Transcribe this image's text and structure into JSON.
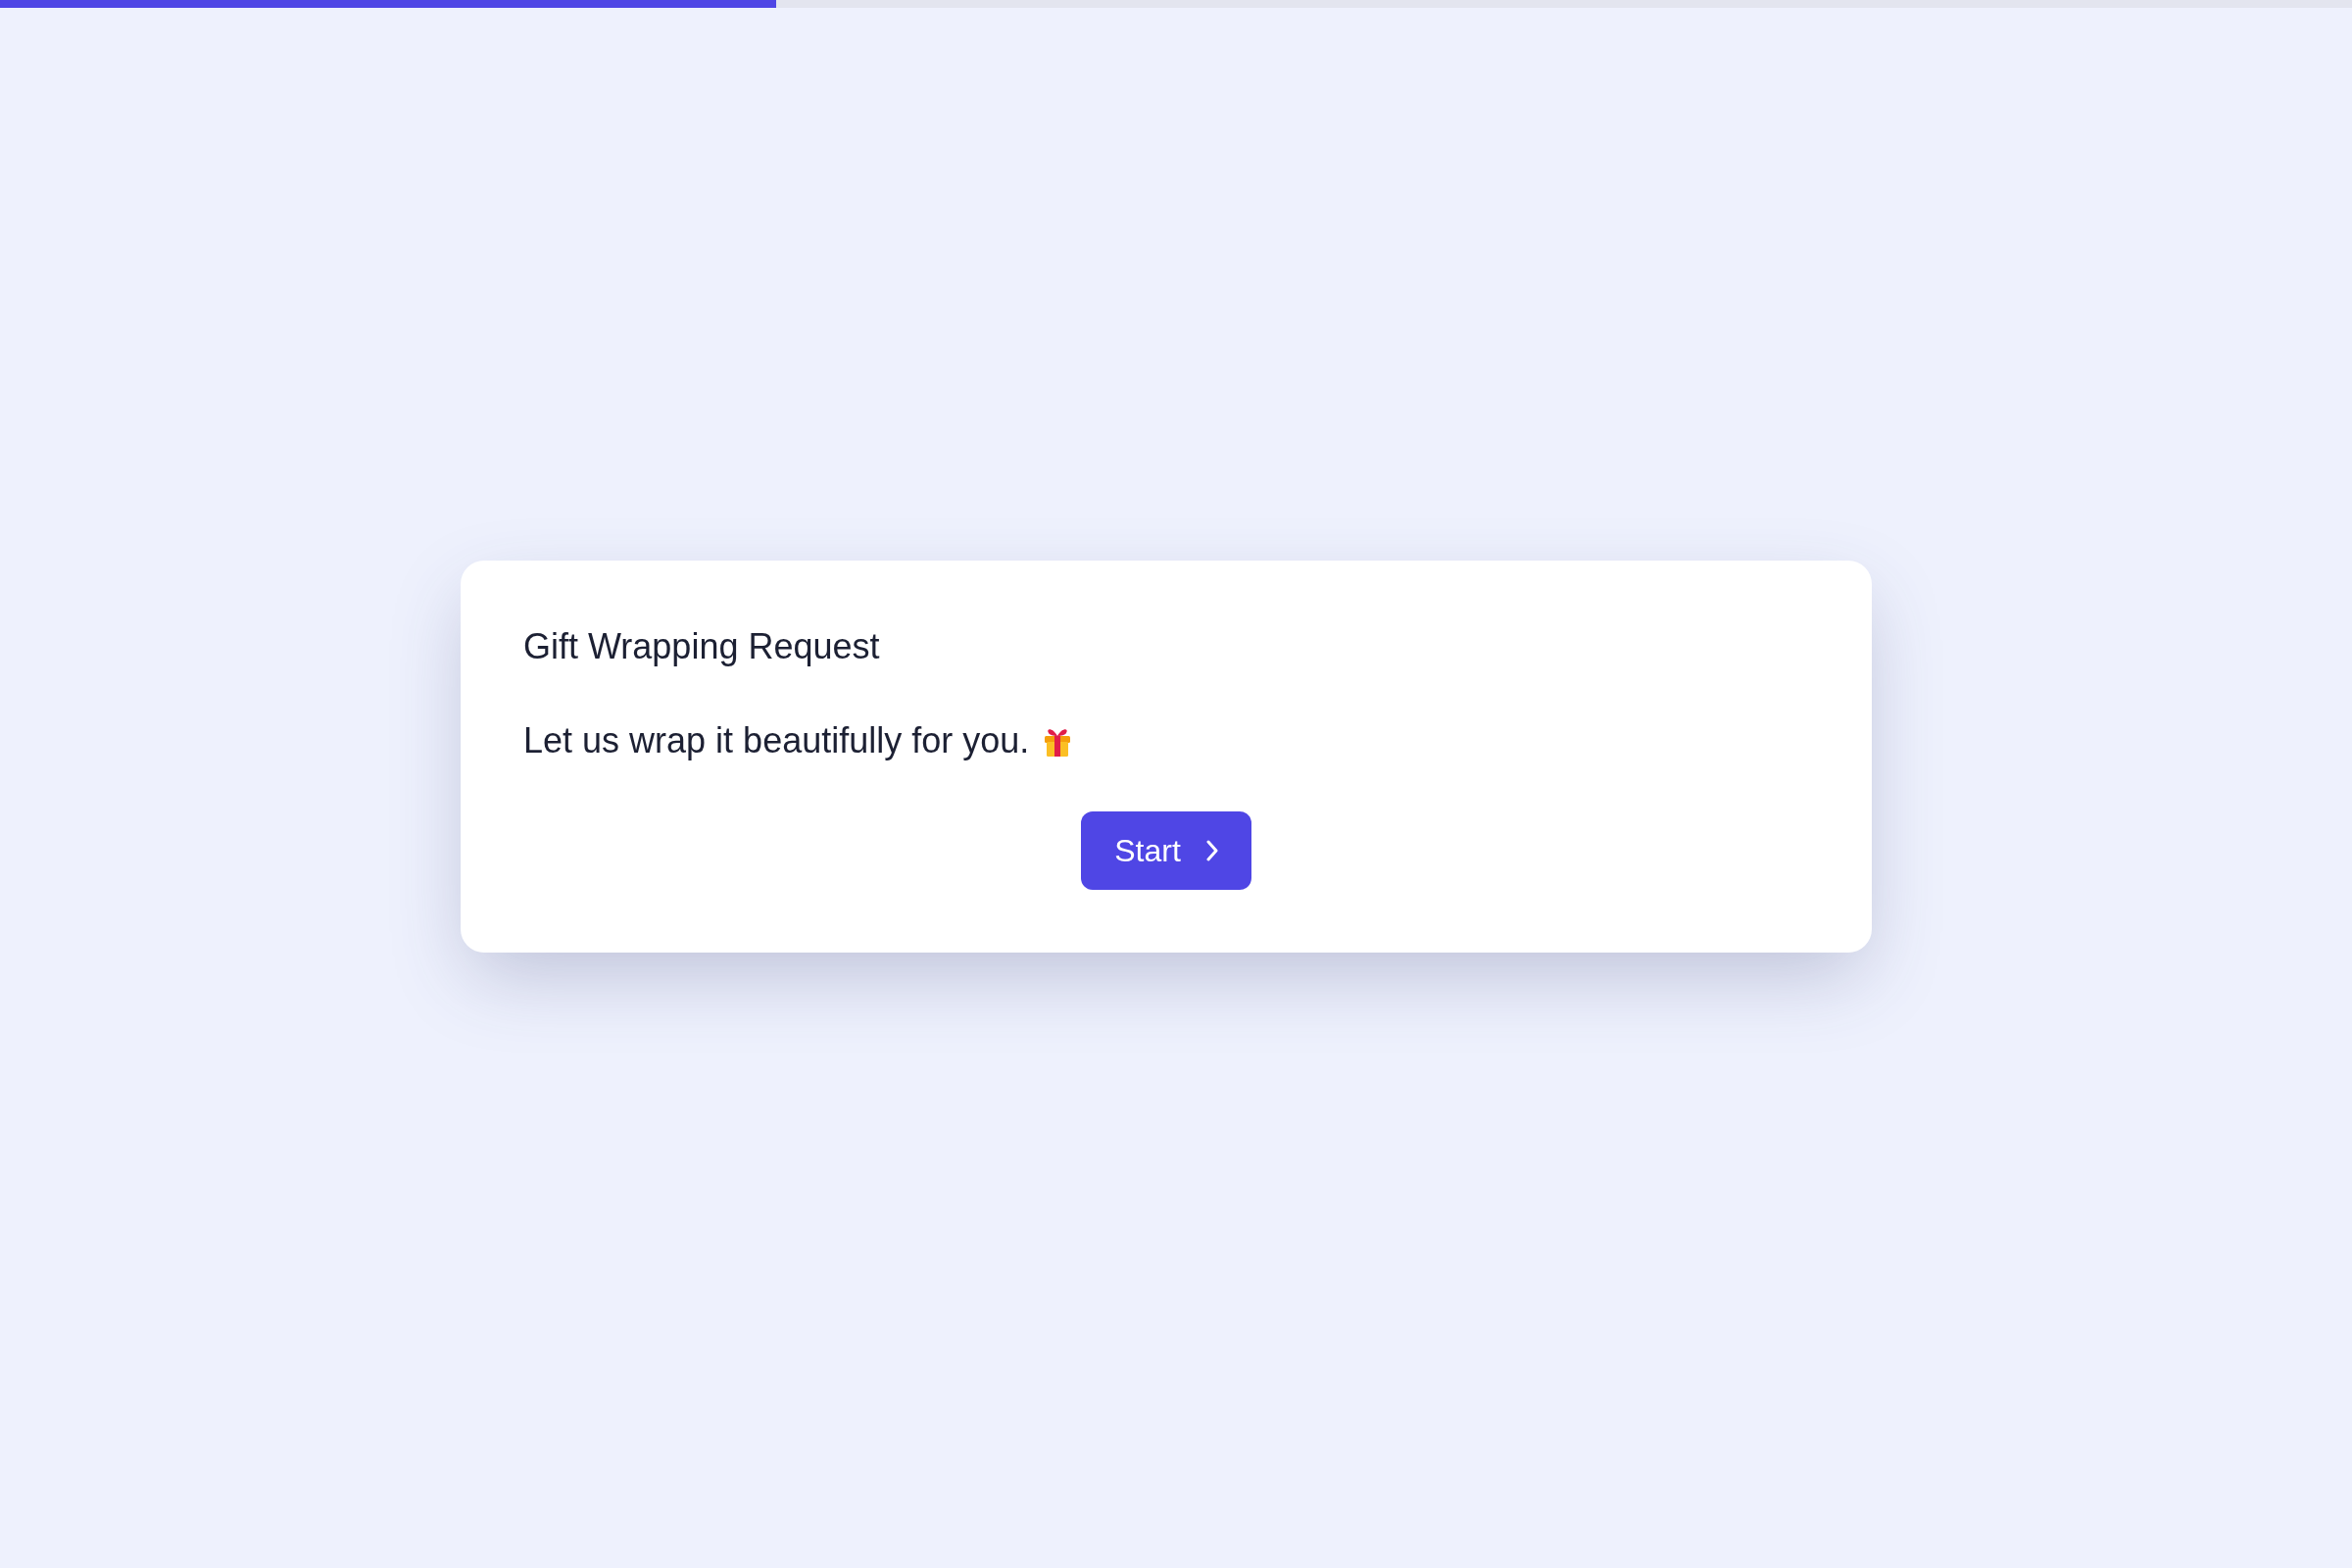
{
  "progress": {
    "level": 0.33
  },
  "card": {
    "title": "Gift Wrapping Request",
    "message": "Let us wrap it beautifully for you.",
    "button": {
      "label": "Start"
    }
  }
}
